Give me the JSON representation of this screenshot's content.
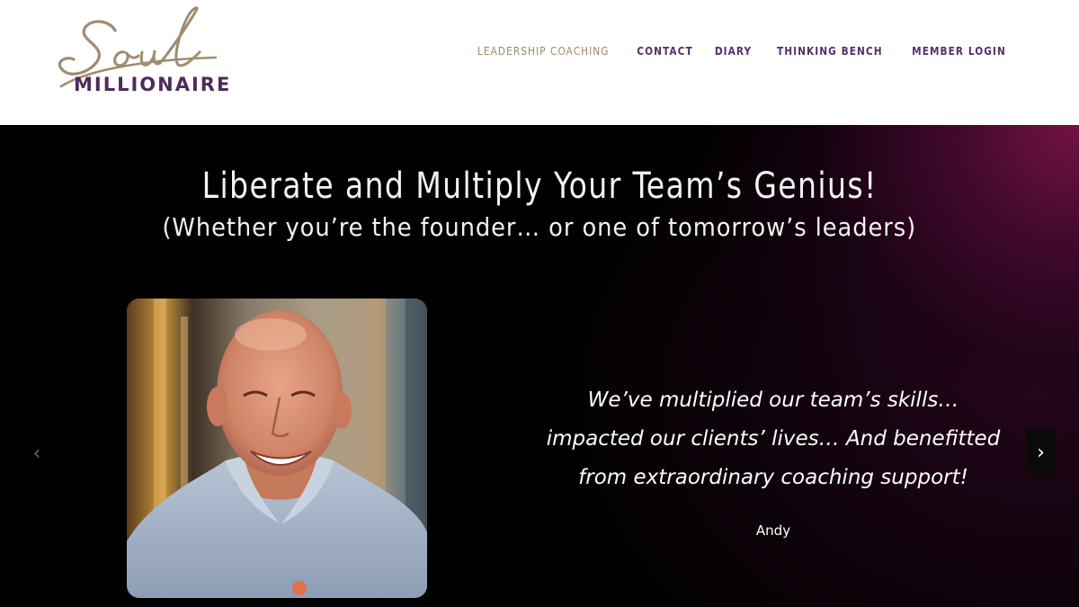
{
  "header": {
    "logo": {
      "script_text": "Soul",
      "word_text": "MILLIONAIRE",
      "script_color": "#a08d70",
      "word_color": "#4f2a5c"
    },
    "nav": [
      {
        "label": "LEADERSHIP COACHING",
        "active": true
      },
      {
        "label": "CONTACT",
        "active": false
      },
      {
        "label": "DIARY",
        "active": false
      },
      {
        "label": "THINKING BENCH",
        "active": false
      },
      {
        "label": "MEMBER LOGIN",
        "active": false
      }
    ],
    "colors": {
      "nav_active": "#9b8a68",
      "nav": "#5a2d6b"
    }
  },
  "hero": {
    "title": "Liberate and Multiply Your Team’s Genius!",
    "subtitle": "(Whether you’re the founder… or one of tomorrow’s leaders)",
    "testimonial": {
      "quote_lines": [
        "We’ve multiplied our team’s skills…",
        "impacted our clients’ lives… And benefitted",
        "from extraordinary coaching support!"
      ],
      "author": "Andy"
    },
    "carousel": {
      "prev_icon": "chevron-left-icon",
      "next_icon": "chevron-right-icon"
    },
    "colors": {
      "background": "#000000",
      "accent_glow": "#781446"
    }
  }
}
